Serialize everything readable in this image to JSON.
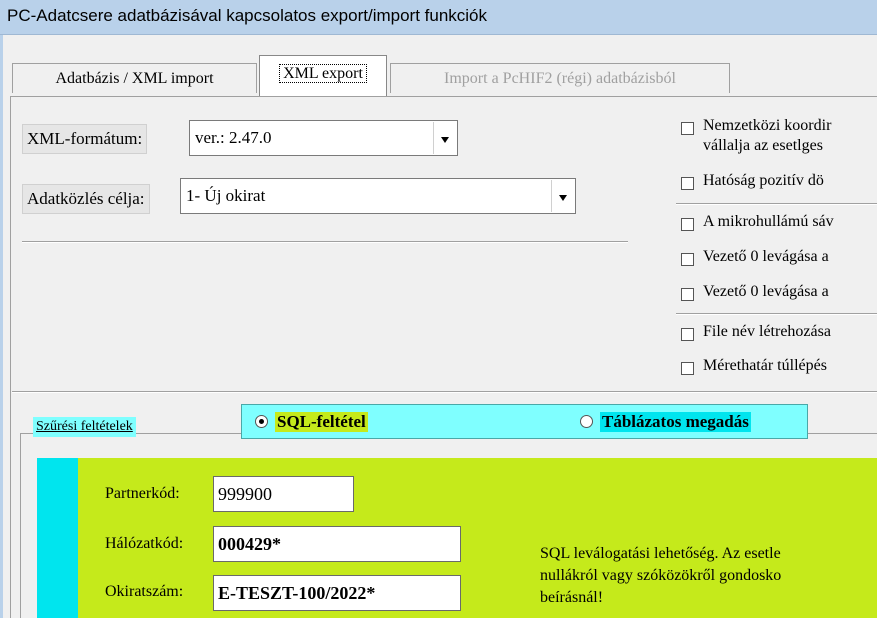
{
  "window": {
    "title": "PC-Adatcsere adatbázisával kapcsolatos export/import funkciók"
  },
  "tabs": [
    {
      "label": "Adatbázis / XML import"
    },
    {
      "label": "XML export"
    },
    {
      "label": "Import a PcHIF2 (régi) adatbázisból"
    }
  ],
  "export": {
    "format_label": "XML-formátum:",
    "format_value": "ver.: 2.47.0",
    "purpose_label": "Adatközlés célja:",
    "purpose_value": "1- Új okirat"
  },
  "options": [
    {
      "label": "Nemzetközi koordir",
      "label2": "vállalja az esetlges"
    },
    {
      "label": "Hatóság pozitív dö"
    },
    {
      "label": "A mikrohullámú sáv"
    },
    {
      "label": "Vezető 0 levágása a"
    },
    {
      "label": "Vezető 0 levágása a"
    },
    {
      "label": "File név létrehozása"
    },
    {
      "label": "Mérethatár túllépés"
    }
  ],
  "filter": {
    "legend": "Szűrési feltételek",
    "radio_sql": "SQL-feltétel",
    "radio_table": "Táblázatos megadás",
    "partner_label": "Partnerkód:",
    "partner_value": "999900",
    "network_label": "Hálózatkód:",
    "network_value": "000429*",
    "doc_label": "Okiratszám:",
    "doc_value": "E-TESZT-100/2022*",
    "hint_line1": "SQL leválogatási lehetőség. Az esetle",
    "hint_line2": "nullákról vagy szóközökről gondosko",
    "hint_line3": "beírásnál!"
  },
  "colors": {
    "titlebar": "#b9d1ea",
    "cyan": "#7fffff",
    "lime": "#c5ea1b",
    "teal": "#00e5ee"
  }
}
